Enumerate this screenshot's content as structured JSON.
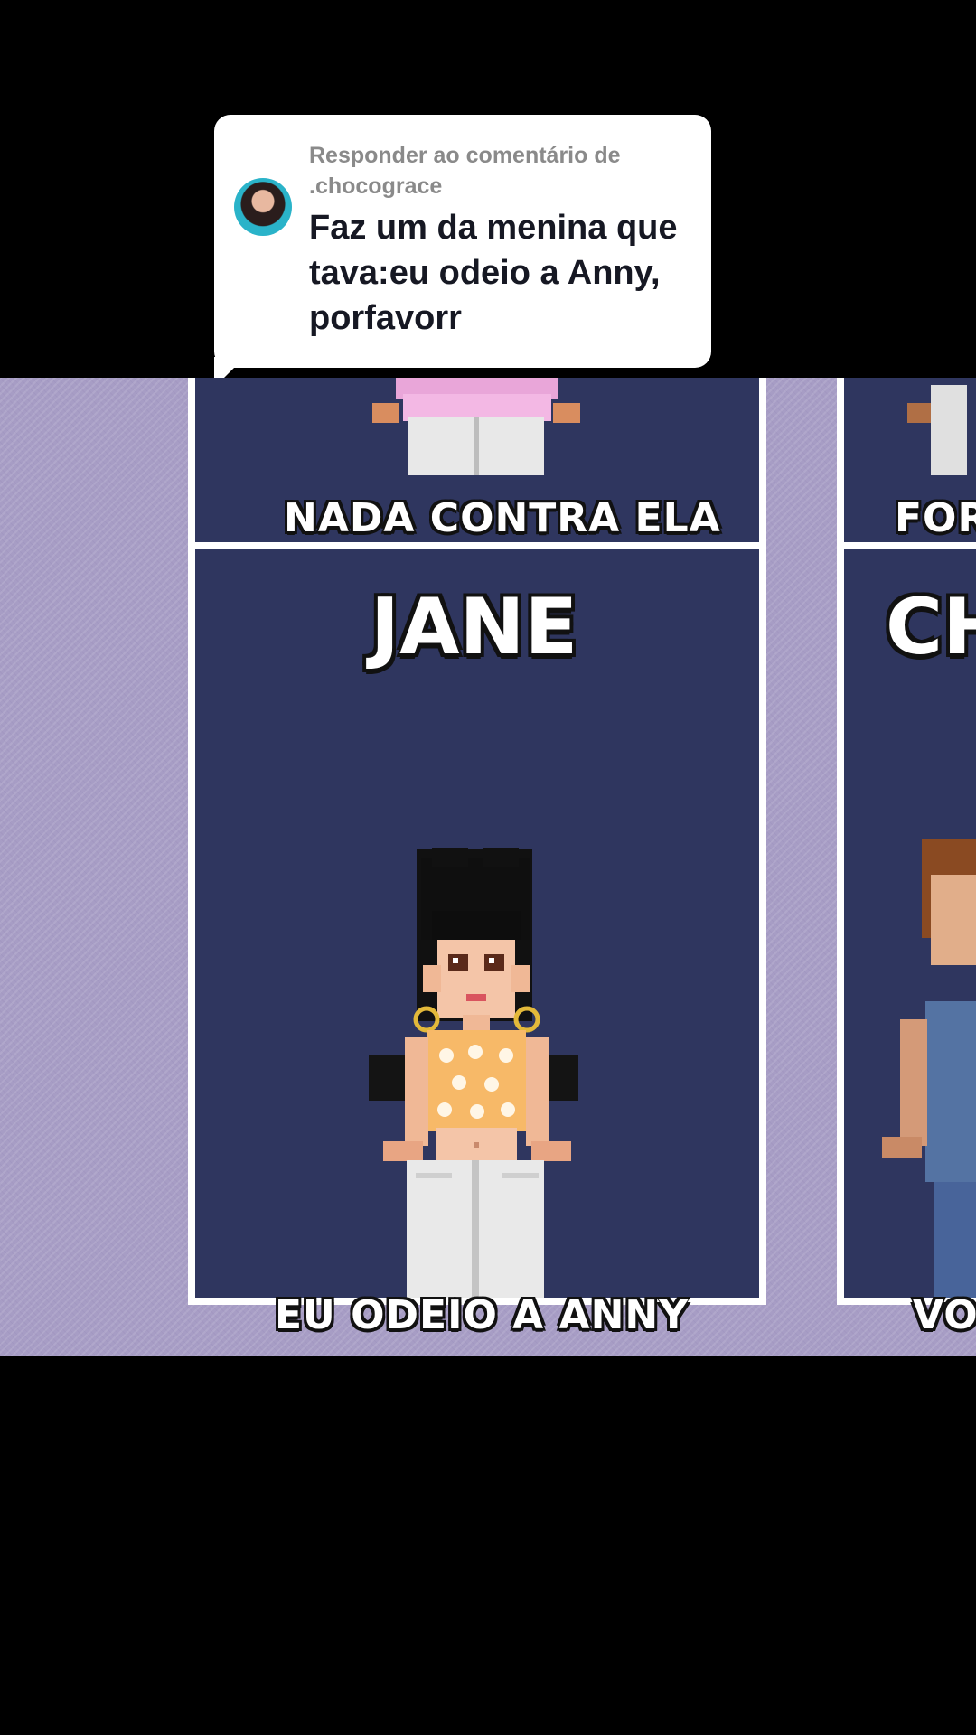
{
  "reply_bubble": {
    "label": "Responder ao comentário de .chocograce",
    "comment": "Faz um da menina que tava:eu odeio a Anny, porfavorr"
  },
  "grid": {
    "top_left_caption": "NADA CONTRA ELA",
    "top_right_caption": "FOR",
    "main_panel_title": "JANE",
    "main_panel_caption": "EU ODEIO A ANNY",
    "right_panel_title": "CH",
    "right_panel_caption": "VO"
  },
  "colors": {
    "panel_bg": "#2f365f",
    "scene_bg": "#a79dc5"
  }
}
